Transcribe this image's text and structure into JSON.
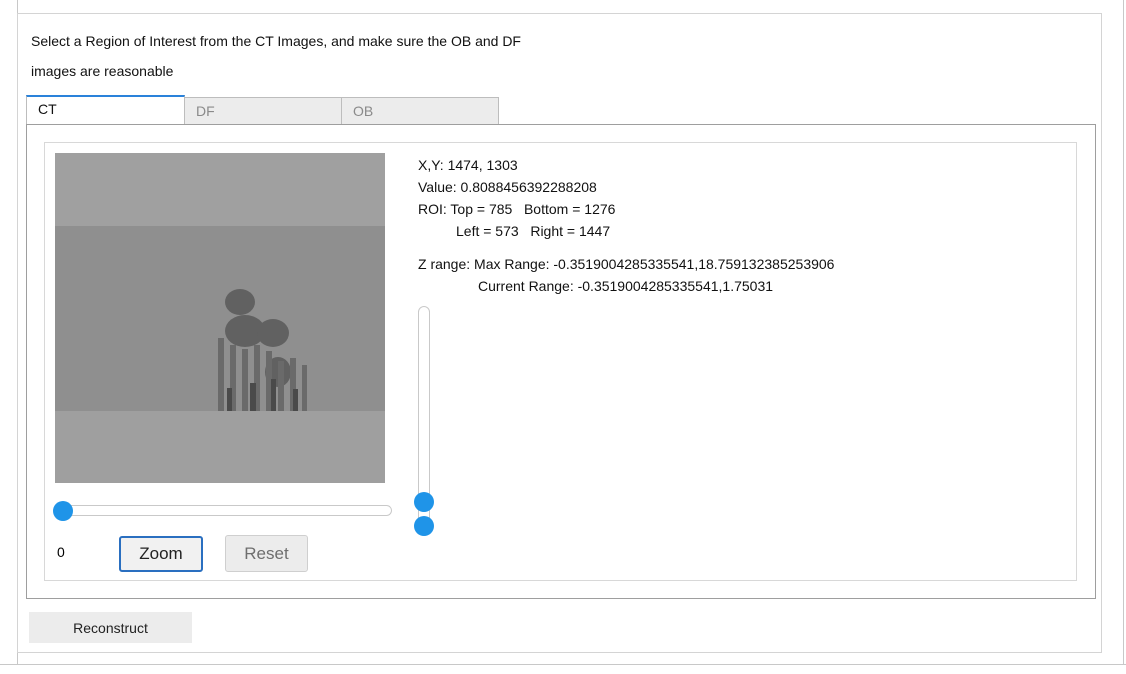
{
  "instructions": {
    "line1": "Select a Region of Interest from the CT Images, and make sure the OB and DF",
    "line2": "images are reasonable"
  },
  "tabs": [
    {
      "label": "CT",
      "active": true
    },
    {
      "label": "DF",
      "active": false
    },
    {
      "label": "OB",
      "active": false
    }
  ],
  "viewer": {
    "image_slider_value": "0",
    "zoom_label": "Zoom",
    "reset_label": "Reset"
  },
  "info": {
    "xy": "X,Y: 1474, 1303",
    "value": "Value: 0.8088456392288208",
    "roi_top_bottom": "ROI: Top = 785   Bottom = 1276",
    "roi_left_right": "Left = 573   Right = 1447",
    "z_max_range": "Z range: Max Range: -0.3519004285335541,18.759132385253906",
    "z_current_range": "Current Range: -0.3519004285335541,1.75031"
  },
  "z_slider": {
    "max_range": [
      -0.3519004285335541,
      18.759132385253906
    ],
    "current_range": [
      -0.3519004285335541,
      1.75031
    ],
    "accent_color": "#1f94e8"
  },
  "actions": {
    "reconstruct_label": "Reconstruct"
  },
  "colors": {
    "accent": "#2a82da",
    "slider_handle": "#1f94e8"
  }
}
